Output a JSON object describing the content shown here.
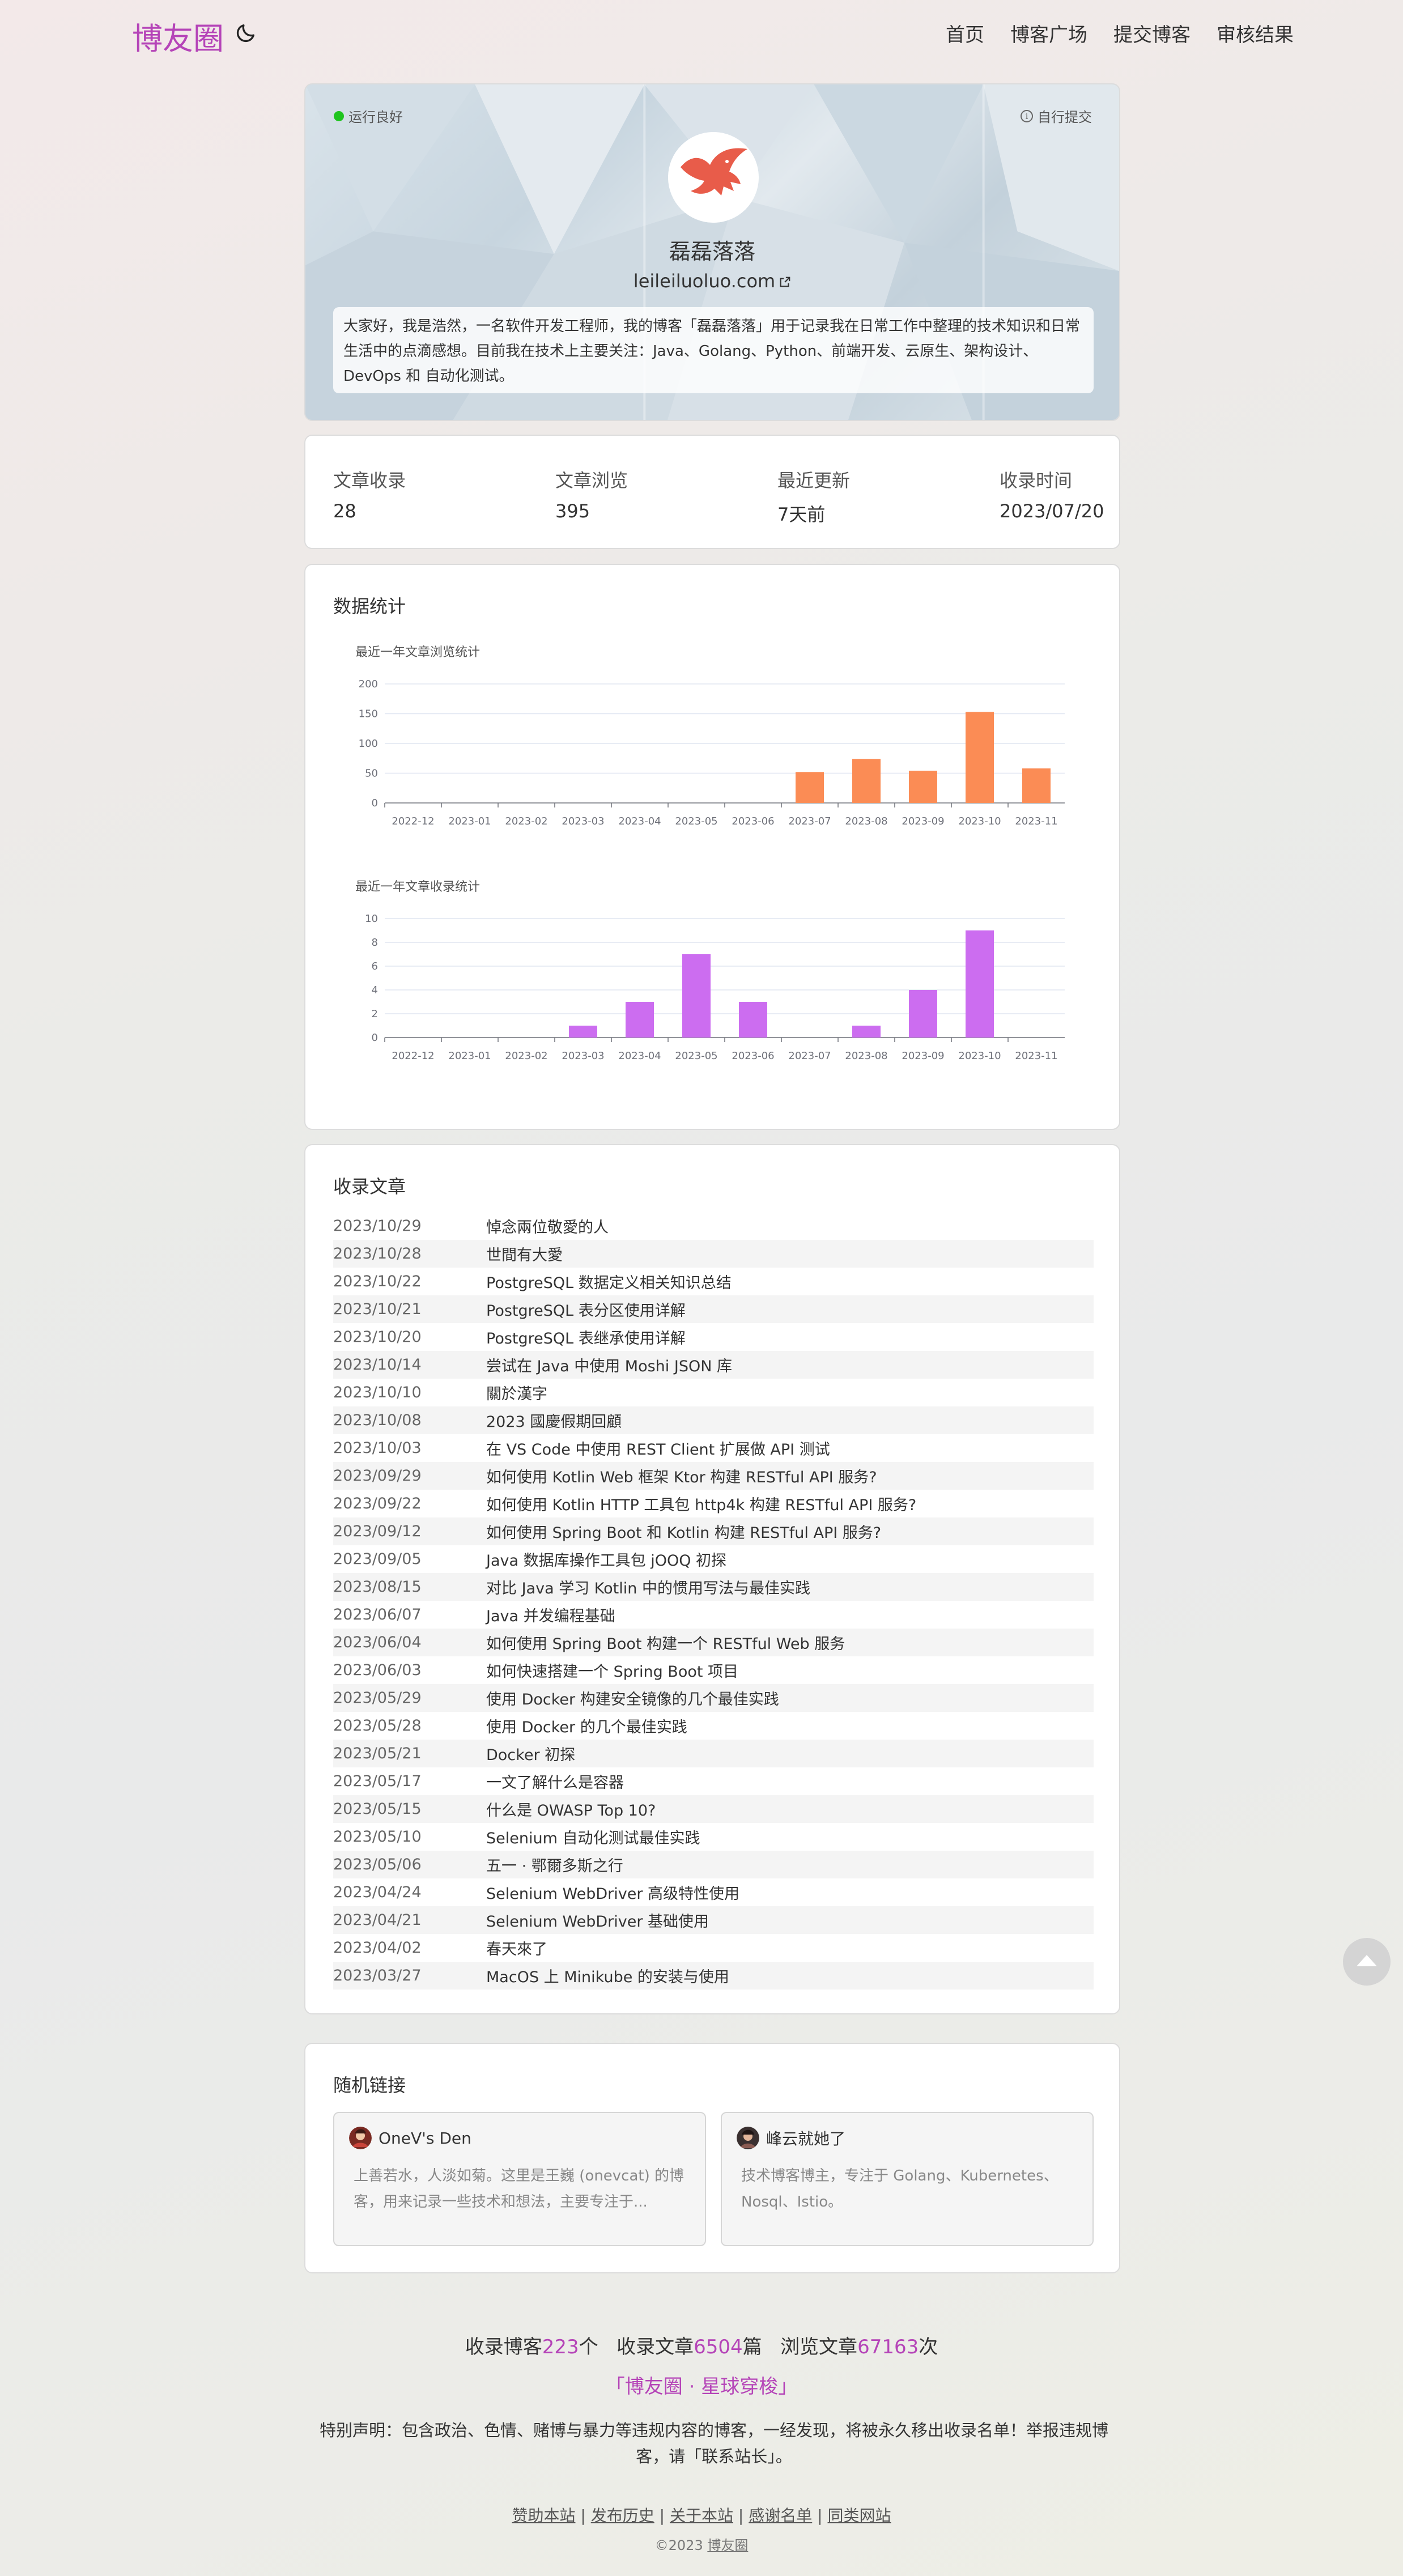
{
  "nav": {
    "brand": "博友圈",
    "links": [
      "首页",
      "博客广场",
      "提交博客",
      "审核结果"
    ]
  },
  "profile": {
    "status": "运行良好",
    "self_submit": "自行提交",
    "name": "磊磊落落",
    "url": "leileiluoluo.com",
    "intro": "大家好，我是浩然，一名软件开发工程师，我的博客「磊磊落落」用于记录我在日常工作中整理的技术知识和日常生活中的点滴感想。目前我在技术上主要关注：Java、Golang、Python、前端开发、云原生、架构设计、DevOps 和 自动化测试。"
  },
  "stats": [
    {
      "label": "文章收录",
      "value": "28"
    },
    {
      "label": "文章浏览",
      "value": "395"
    },
    {
      "label": "最近更新",
      "value": "7天前"
    },
    {
      "label": "收录时间",
      "value": "2023/07/20"
    }
  ],
  "charts_section": {
    "title": "数据统计"
  },
  "chart_data": [
    {
      "type": "bar",
      "title": "最近一年文章浏览统计",
      "categories": [
        "2022-12",
        "2023-01",
        "2023-02",
        "2023-03",
        "2023-04",
        "2023-05",
        "2023-06",
        "2023-07",
        "2023-08",
        "2023-09",
        "2023-10",
        "2023-11"
      ],
      "values": [
        0,
        0,
        0,
        0,
        0,
        0,
        0,
        52,
        74,
        54,
        153,
        58
      ],
      "yticks": [
        0,
        50,
        100,
        150,
        200
      ],
      "ylim": [
        0,
        200
      ],
      "color": "#fb8c55",
      "grid": true
    },
    {
      "type": "bar",
      "title": "最近一年文章收录统计",
      "categories": [
        "2022-12",
        "2023-01",
        "2023-02",
        "2023-03",
        "2023-04",
        "2023-05",
        "2023-06",
        "2023-07",
        "2023-08",
        "2023-09",
        "2023-10",
        "2023-11"
      ],
      "values": [
        0,
        0,
        0,
        1,
        3,
        7,
        3,
        0,
        1,
        4,
        9,
        0
      ],
      "yticks": [
        0,
        2,
        4,
        6,
        8,
        10
      ],
      "ylim": [
        0,
        10
      ],
      "color": "#cc6df0",
      "grid": true
    }
  ],
  "articles_section": {
    "title": "收录文章",
    "items": [
      {
        "date": "2023/10/29",
        "title": "悼念兩位敬愛的人"
      },
      {
        "date": "2023/10/28",
        "title": "世間有大愛"
      },
      {
        "date": "2023/10/22",
        "title": "PostgreSQL 数据定义相关知识总结"
      },
      {
        "date": "2023/10/21",
        "title": "PostgreSQL 表分区使用详解"
      },
      {
        "date": "2023/10/20",
        "title": "PostgreSQL 表继承使用详解"
      },
      {
        "date": "2023/10/14",
        "title": "尝试在 Java 中使用 Moshi JSON 库"
      },
      {
        "date": "2023/10/10",
        "title": "關於漢字"
      },
      {
        "date": "2023/10/08",
        "title": "2023 國慶假期回顧"
      },
      {
        "date": "2023/10/03",
        "title": "在 VS Code 中使用 REST Client 扩展做 API 测试"
      },
      {
        "date": "2023/09/29",
        "title": "如何使用 Kotlin Web 框架 Ktor 构建 RESTful API 服务?"
      },
      {
        "date": "2023/09/22",
        "title": "如何使用 Kotlin HTTP 工具包 http4k 构建 RESTful API 服务?"
      },
      {
        "date": "2023/09/12",
        "title": "如何使用 Spring Boot 和 Kotlin 构建 RESTful API 服务?"
      },
      {
        "date": "2023/09/05",
        "title": "Java 数据库操作工具包 jOOQ 初探"
      },
      {
        "date": "2023/08/15",
        "title": "对比 Java 学习 Kotlin 中的惯用写法与最佳实践"
      },
      {
        "date": "2023/06/07",
        "title": "Java 并发编程基础"
      },
      {
        "date": "2023/06/04",
        "title": "如何使用 Spring Boot 构建一个 RESTful Web 服务"
      },
      {
        "date": "2023/06/03",
        "title": "如何快速搭建一个 Spring Boot 项目"
      },
      {
        "date": "2023/05/29",
        "title": "使用 Docker 构建安全镜像的几个最佳实践"
      },
      {
        "date": "2023/05/28",
        "title": "使用 Docker 的几个最佳实践"
      },
      {
        "date": "2023/05/21",
        "title": "Docker 初探"
      },
      {
        "date": "2023/05/17",
        "title": "一文了解什么是容器"
      },
      {
        "date": "2023/05/15",
        "title": "什么是 OWASP Top 10?"
      },
      {
        "date": "2023/05/10",
        "title": "Selenium 自动化测试最佳实践"
      },
      {
        "date": "2023/05/06",
        "title": "五一 · 鄂爾多斯之行"
      },
      {
        "date": "2023/04/24",
        "title": "Selenium WebDriver 高级特性使用"
      },
      {
        "date": "2023/04/21",
        "title": "Selenium WebDriver 基础使用"
      },
      {
        "date": "2023/04/02",
        "title": "春天來了"
      },
      {
        "date": "2023/03/27",
        "title": "MacOS 上 Minikube 的安装与使用"
      }
    ]
  },
  "links_section": {
    "title": "随机链接",
    "items": [
      {
        "name": "OneV's Den",
        "desc": "上善若水，人淡如菊。这里是王巍 (onevcat) 的博客，用来记录一些技术和想法，主要专注于..."
      },
      {
        "name": "峰云就她了",
        "desc": "技术博客博主，专注于 Golang、Kubernetes、Nosql、Istio。"
      }
    ]
  },
  "footer": {
    "stats": {
      "blogs_label": "收录博客",
      "blogs_num": "223",
      "blogs_unit": "个",
      "articles_label": "收录文章",
      "articles_num": "6504",
      "articles_unit": "篇",
      "views_label": "浏览文章",
      "views_num": "67163",
      "views_unit": "次"
    },
    "slogan": "「博友圈 · 星球穿梭」",
    "notice": "特别声明：包含政治、色情、赌博与暴力等违规内容的博客，一经发现，将被永久移出收录名单！举报违规博客，请「联系站长」。",
    "links": [
      "赞助本站",
      "发布历史",
      "关于本站",
      "感谢名单",
      "同类网站"
    ],
    "separator": "|",
    "copyright": "©2023",
    "copyright_link": "博友圈"
  }
}
